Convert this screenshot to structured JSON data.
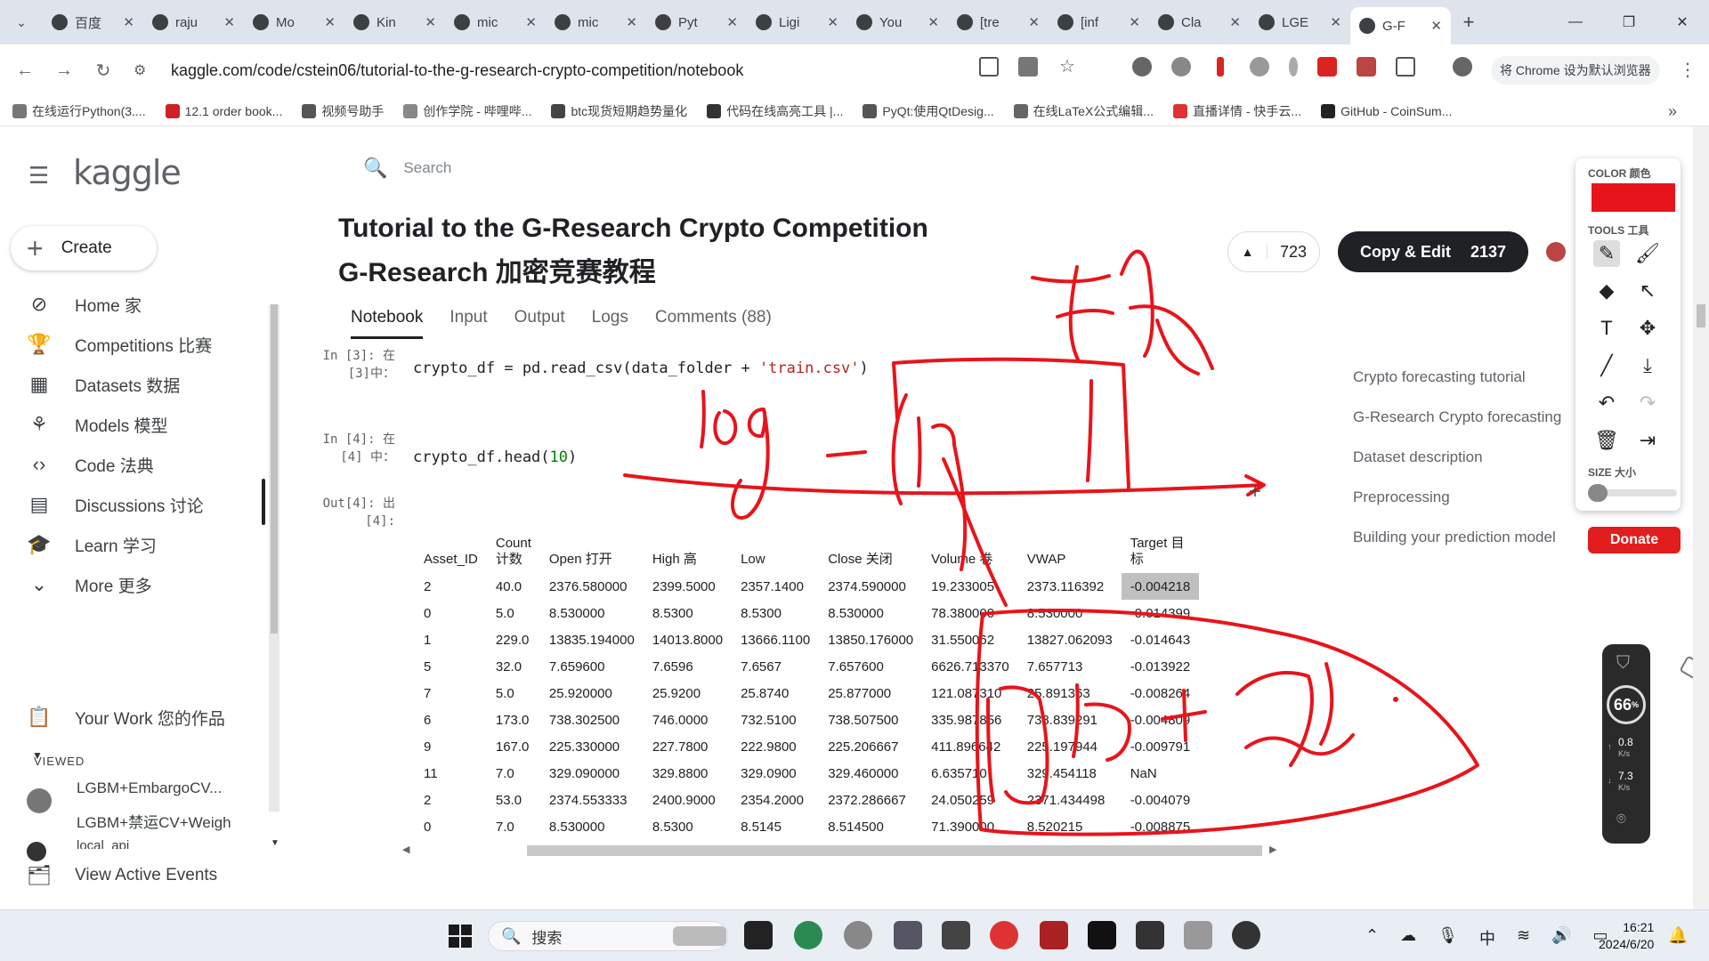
{
  "browser": {
    "tabs": [
      {
        "label": "百度",
        "icon": "box-icon"
      },
      {
        "label": "raju",
        "icon": "github-icon"
      },
      {
        "label": "Mo",
        "icon": "github-icon"
      },
      {
        "label": "Kin",
        "icon": "k-icon"
      },
      {
        "label": "mic",
        "icon": "github-icon"
      },
      {
        "label": "mic",
        "icon": "github-icon"
      },
      {
        "label": "Pyt",
        "icon": "python-icon"
      },
      {
        "label": "Ligi",
        "icon": "github-icon"
      },
      {
        "label": "You",
        "icon": "kaggle-icon"
      },
      {
        "label": "[tre",
        "icon": "kaggle-icon"
      },
      {
        "label": "[inf",
        "icon": "kaggle-icon"
      },
      {
        "label": "Cla",
        "icon": "claude-icon"
      },
      {
        "label": "LGE",
        "icon": "kaggle-icon"
      },
      {
        "label": "G-F",
        "icon": "kaggle-icon",
        "active": true
      }
    ],
    "url": "kaggle.com/code/cstein06/tutorial-to-the-g-research-crypto-competition/notebook",
    "default_browser_btn": "将 Chrome 设为默认浏览器",
    "bookmarks": [
      "在线运行Python(3....",
      "12.1 order book...",
      "视频号助手",
      "创作学院 - 哔哩哔...",
      "btc现货短期趋势量化",
      "代码在线高亮工具 |...",
      "PyQt:使用QtDesig...",
      "在线LaTeX公式编辑...",
      "直播详情 - 快手云...",
      "GitHub - CoinSum..."
    ]
  },
  "kaggle": {
    "logo": "kaggle",
    "create": "Create",
    "nav": [
      {
        "label": "Home 家",
        "icon": "compass-icon"
      },
      {
        "label": "Competitions 比赛",
        "icon": "trophy-icon"
      },
      {
        "label": "Datasets 数据",
        "icon": "table-icon"
      },
      {
        "label": "Models 模型",
        "icon": "models-icon"
      },
      {
        "label": "Code 法典",
        "icon": "code-icon"
      },
      {
        "label": "Discussions 讨论",
        "icon": "discussion-icon"
      },
      {
        "label": "Learn 学习",
        "icon": "graduation-cap-icon"
      },
      {
        "label": "More 更多",
        "icon": "chevron-down-icon"
      }
    ],
    "your_work": "Your Work 您的作品",
    "viewed_header": "VIEWED",
    "viewed": [
      "LGBM+EmbargoCV...",
      "LGBM+禁运CV+Weigh",
      "local_api"
    ],
    "view_active_events": "View Active Events",
    "search_placeholder": "Search"
  },
  "notebook": {
    "title_en": "Tutorial to the G-Research Crypto Competition",
    "title_zh": "G-Research 加密竞赛教程",
    "votes": "723",
    "copy_edit": "Copy & Edit",
    "copy_edit_count": "2137",
    "tabs": [
      "Notebook",
      "Input",
      "Output",
      "Logs",
      "Comments (88)"
    ],
    "cells": [
      {
        "prompt": "In [3]: 在\n[3]中：",
        "code_parts": [
          "crypto_df = pd.read_csv(data_folder + ",
          "'train.csv'",
          ")"
        ]
      },
      {
        "prompt": "In [4]: 在\n[4] 中：",
        "code_parts": [
          "crypto_df.head(",
          "10",
          ")"
        ]
      }
    ],
    "out_prompt": "Out[4]: 出\n[4]:",
    "table": {
      "columns": [
        "Asset_ID",
        "Count\n计数",
        "Open 打开",
        "High 高",
        "Low",
        "Close 关闭",
        "Volume 卷",
        "VWAP",
        "Target 目\n标"
      ],
      "rows": [
        [
          "2",
          "40.0",
          "2376.580000",
          "2399.5000",
          "2357.1400",
          "2374.590000",
          "19.233005",
          "2373.116392",
          "-0.004218"
        ],
        [
          "0",
          "5.0",
          "8.530000",
          "8.5300",
          "8.5300",
          "8.530000",
          "78.380000",
          "8.530000",
          "-0.014399"
        ],
        [
          "1",
          "229.0",
          "13835.194000",
          "14013.8000",
          "13666.1100",
          "13850.176000",
          "31.550062",
          "13827.062093",
          "-0.014643"
        ],
        [
          "5",
          "32.0",
          "7.659600",
          "7.6596",
          "7.6567",
          "7.657600",
          "6626.713370",
          "7.657713",
          "-0.013922"
        ],
        [
          "7",
          "5.0",
          "25.920000",
          "25.9200",
          "25.8740",
          "25.877000",
          "121.087310",
          "25.891363",
          "-0.008264"
        ],
        [
          "6",
          "173.0",
          "738.302500",
          "746.0000",
          "732.5100",
          "738.507500",
          "335.987856",
          "738.839291",
          "-0.004809"
        ],
        [
          "9",
          "167.0",
          "225.330000",
          "227.7800",
          "222.9800",
          "225.206667",
          "411.896642",
          "225.197944",
          "-0.009791"
        ],
        [
          "11",
          "7.0",
          "329.090000",
          "329.8800",
          "329.0900",
          "329.460000",
          "6.635710",
          "329.454118",
          "NaN"
        ],
        [
          "2",
          "53.0",
          "2374.553333",
          "2400.9000",
          "2354.2000",
          "2372.286667",
          "24.050259",
          "2371.434498",
          "-0.004079"
        ],
        [
          "0",
          "7.0",
          "8.530000",
          "8.5300",
          "8.5145",
          "8.514500",
          "71.390000",
          "8.520215",
          "-0.008875"
        ]
      ]
    },
    "toc": [
      "Crypto forecasting tutorial",
      "G-Research Crypto forecasting",
      "Dataset description",
      "Preprocessing",
      "Building your prediction model"
    ],
    "donate": "Donate"
  },
  "annotation_tool": {
    "color_label": "COLOR 颜色",
    "color": "#e8141b",
    "tools_label": "TOOLS 工具",
    "size_label": "SIZE 大小",
    "tools": [
      "pencil-icon",
      "marker-icon",
      "eraser-icon",
      "pointer-icon",
      "text-icon",
      "move-icon",
      "line-icon",
      "download-icon",
      "undo-icon",
      "redo-icon",
      "trash-icon",
      "exit-icon"
    ]
  },
  "speed_widget": {
    "percent": "66",
    "percent_unit": "%",
    "up": "0.8",
    "down": "7.3",
    "unit": "K/s"
  },
  "taskbar": {
    "search": "搜索",
    "ime": "中",
    "time": "16:21",
    "date": "2024/6/20"
  },
  "ink_text": {
    "note1": "log - log",
    "note2": "梯度",
    "note3": "代码 + 函数"
  }
}
